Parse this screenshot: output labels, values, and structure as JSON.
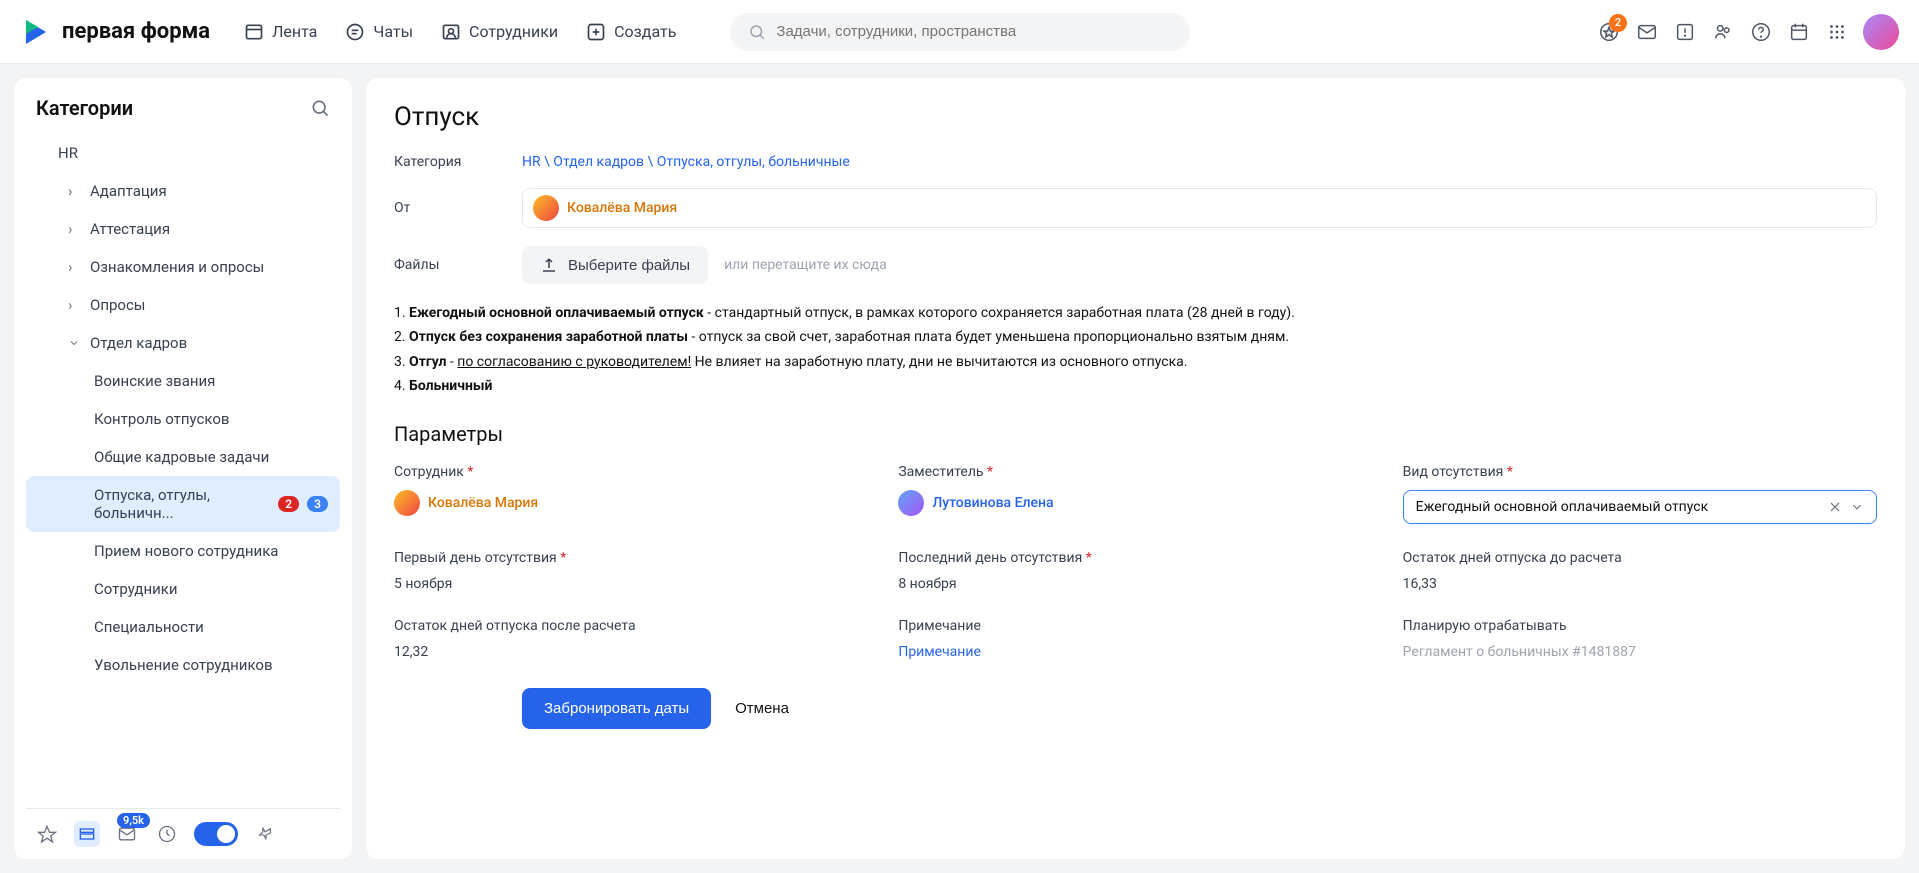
{
  "app": {
    "name": "первая форма"
  },
  "nav": {
    "feed": "Лента",
    "chats": "Чаты",
    "employees": "Сотрудники",
    "create": "Создать"
  },
  "search": {
    "placeholder": "Задачи, сотрудники, пространства"
  },
  "header": {
    "notif_count": "2"
  },
  "sidebar": {
    "title": "Категории",
    "items": [
      {
        "label": "HR"
      },
      {
        "label": "Адаптация"
      },
      {
        "label": "Аттестация"
      },
      {
        "label": "Ознакомления и опросы"
      },
      {
        "label": "Опросы"
      },
      {
        "label": "Отдел кадров"
      },
      {
        "label": "Воинские звания"
      },
      {
        "label": "Контроль отпусков"
      },
      {
        "label": "Общие кадровые задачи"
      },
      {
        "label": "Отпуска, отгулы, больничн...",
        "badge_red": "2",
        "badge_blue": "3"
      },
      {
        "label": "Прием нового сотрудника"
      },
      {
        "label": "Сотрудники"
      },
      {
        "label": "Специальности"
      },
      {
        "label": "Увольнение сотрудников"
      }
    ],
    "bottom_badge": "9,5k"
  },
  "page": {
    "title": "Отпуск",
    "cat_label": "Категория",
    "breadcrumb": "HR \\ Отдел кадров \\ Отпуска, отгулы, больничные",
    "from_label": "От",
    "from_user": "Ковалёва Мария",
    "files_label": "Файлы",
    "files_btn": "Выберите файлы",
    "files_hint": "или перетащите их сюда",
    "desc": {
      "n1": "1. ",
      "t1": "Ежегодный основной оплачиваемый отпуск",
      "t1r": " - стандартный отпуск, в рамках которого сохраняется заработная плата (28 дней в году).",
      "n2": "2. ",
      "t2": "Отпуск без сохранения заработной платы",
      "t2r": " - отпуск за свой счет, заработная плата будет уменьшена пропорционально взятым дням.",
      "n3": "3. ",
      "t3": "Отгул",
      "t3m": " - ",
      "t3u": "по согласованию с руководителем!",
      "t3r": " Не влияет на заработную плату, дни не вычитаются из основного отпуска.",
      "n4": "4. ",
      "t4": "Больничный"
    },
    "params_title": "Параметры",
    "params": {
      "employee_label": "Сотрудник",
      "employee_name": "Ковалёва Мария",
      "deputy_label": "Заместитель",
      "deputy_name": "Лутовинова Елена",
      "absence_type_label": "Вид отсутствия",
      "absence_type_value": "Ежегодный основной оплачиваемый отпуск",
      "first_day_label": "Первый день отсутствия",
      "first_day_value": "5 ноября",
      "last_day_label": "Последний день отсутствия",
      "last_day_value": "8 ноября",
      "balance_before_label": "Остаток дней отпуска до расчета",
      "balance_before_value": "16,33",
      "balance_after_label": "Остаток дней отпуска после расчета",
      "balance_after_value": "12,32",
      "note_label": "Примечание",
      "note_placeholder": "Примечание",
      "plan_label": "Планирую отрабатывать",
      "plan_hint": "Регламент о больничных #1481887"
    },
    "actions": {
      "book": "Забронировать даты",
      "cancel": "Отмена"
    }
  }
}
